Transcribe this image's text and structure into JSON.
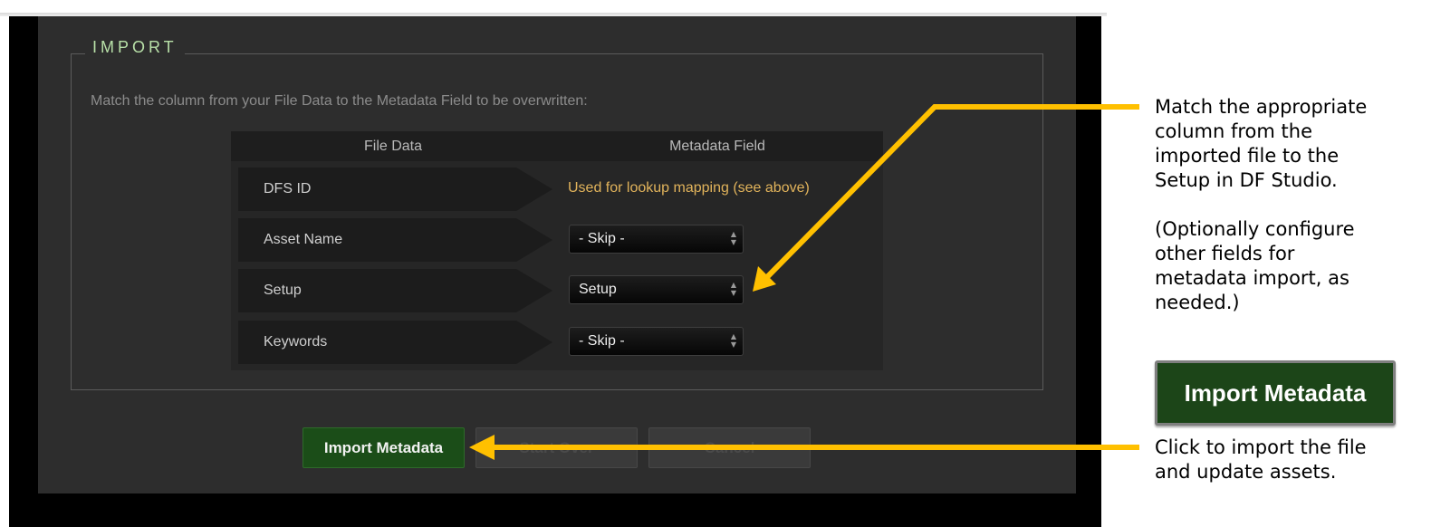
{
  "section": {
    "legend": "IMPORT",
    "instruction": "Match the column from your File Data to the Metadata Field to be overwritten:"
  },
  "mapping_table": {
    "headers": [
      "File Data",
      "Metadata Field"
    ],
    "rows": [
      {
        "file_data": "DFS ID",
        "metadata_text": "Used for lookup mapping (see above)"
      },
      {
        "file_data": "Asset Name",
        "select_value": "- Skip -"
      },
      {
        "file_data": "Setup",
        "select_value": "Setup"
      },
      {
        "file_data": "Keywords",
        "select_value": "- Skip -"
      }
    ]
  },
  "buttons": {
    "import": "Import Metadata",
    "start_over": "Start Over",
    "cancel": "Cancel"
  },
  "callouts": {
    "mapping_lines": [
      "Match the appropriate",
      "column from the",
      "imported file to the",
      "Setup in DF Studio."
    ],
    "optional_lines": [
      "(Optionally configure",
      "other fields for",
      "metadata import, as",
      "needed.)"
    ],
    "button_sample": "Import Metadata",
    "import_lines": [
      "Click to import the file",
      "and update assets."
    ]
  },
  "colors": {
    "arrow": "#ffc000",
    "legend_text": "#b8e0a8",
    "lookup_text": "#e1b35b",
    "primary_button": "#1b4d18"
  }
}
